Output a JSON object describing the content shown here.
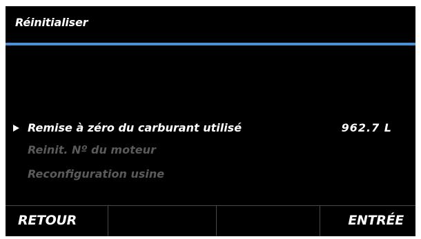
{
  "screen": {
    "title": "Réinitialiser",
    "accent_color": "#4a90d9"
  },
  "menu": {
    "items": [
      {
        "label": "Remise à zéro du carburant utilisé",
        "value": "962.7 L",
        "state": "selected"
      },
      {
        "label": "Reinit. Nº du moteur",
        "state": "disabled"
      },
      {
        "label": "Reconfiguration usine",
        "state": "disabled"
      }
    ]
  },
  "softkeys": {
    "back_label": "RETOUR",
    "key2_label": "",
    "key3_label": "",
    "enter_label": "ENTRÉE"
  }
}
